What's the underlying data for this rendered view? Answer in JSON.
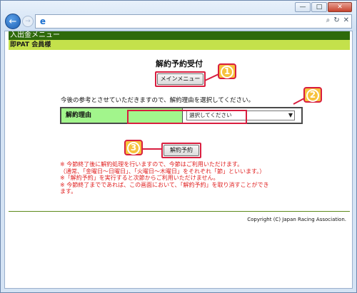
{
  "browser": {
    "controls": {
      "minimize": "—",
      "maximize": "□",
      "close": "✕"
    },
    "address": {
      "icon": "ie-icon",
      "placeholder": ""
    },
    "addr_icons": [
      "search-icon",
      "refresh-icon",
      "close-icon"
    ]
  },
  "page": {
    "menu_header": "入出金メニュー",
    "member_bar": "即PAT 会員様",
    "title": "解約予約受付",
    "main_menu_button": "メインメニュー",
    "instruction": "今後の参考とさせていただきますので、解約理由を選択してください。",
    "reason_label": "解約理由",
    "reason_select": {
      "value": "選択してください",
      "arrow": "▼"
    },
    "reserve_button": "解約予約",
    "notes": [
      "※ 今節終了後に解約処理を行いますので、今節はご利用いただけます。",
      "（通常、「金曜日～日曜日」、「火曜日～木曜日」をそれぞれ「節」といいます。）",
      "※「解約予約」を実行すると次節からご利用いただけません。",
      "※ 今節終了までであれば、この画面において、「解約予約」を取り消すことができ",
      "ます。"
    ],
    "copyright": "Copyright (C) Japan Racing Association."
  },
  "callouts": {
    "one": "1",
    "two": "2",
    "three": "3",
    "accent": "#d81e3f",
    "fill": "#f7c23d"
  },
  "colors": {
    "menu_header_bg": "#2e6a0b",
    "member_bar_bg": "#c4e14b",
    "reason_label_bg": "#a2f58c",
    "notes_text": "#e02020"
  }
}
